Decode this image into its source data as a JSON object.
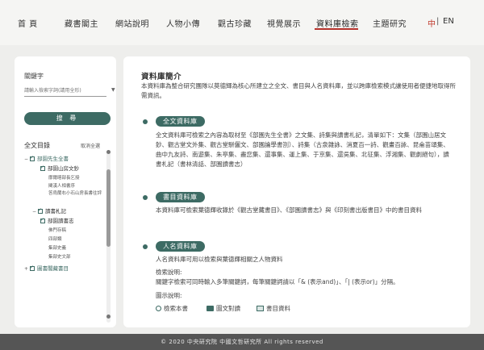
{
  "nav": {
    "items": [
      "首  頁",
      "藏書閣主",
      "網站說明",
      "人物小傳",
      "觀古珍藏",
      "視覺展示",
      "資料庫檢索",
      "主題研究"
    ],
    "lang_zh": "中",
    "lang_sep": "|",
    "lang_en": "EN"
  },
  "left": {
    "keyword_label": "關鍵字",
    "keyword_placeholder": "請輸入檢索字詞(請用全形)",
    "search_button": "搜  尋",
    "tree_title": "全文目錄",
    "toggle_all": "取消全選",
    "tree": [
      {
        "label": "部園先生全書",
        "level": 0,
        "checked": true,
        "toggle": "−"
      },
      {
        "label": "部園山房文鈔",
        "level": 1,
        "checked": true
      },
      {
        "label": "廓爾喀部長乞授",
        "level": 2,
        "small": true
      },
      {
        "label": "閩漢人相書序",
        "level": 2,
        "small": true
      },
      {
        "label": "答烏蘭右小石山房長書往評",
        "level": 2,
        "small": true
      },
      {
        "label": "讀書札記",
        "level": 1,
        "checked": true,
        "toggle": "−"
      },
      {
        "label": "部園讀書志",
        "level": 1,
        "checked": true
      },
      {
        "label": "佛門存稿",
        "level": 2,
        "small": true
      },
      {
        "label": "四部類",
        "level": 2,
        "small": true
      },
      {
        "label": "集部史義",
        "level": 2,
        "small": true
      },
      {
        "label": "集部史文部",
        "level": 2,
        "small": true
      },
      {
        "label": "圖書閣藏書目",
        "level": 0,
        "checked": true,
        "toggle": "+"
      }
    ]
  },
  "right": {
    "heading": "資料庫簡介",
    "intro": "本資料庫為整合研究團隊以莫德輝為核心所建立之全文、書目與人名資料庫，並以跨庫檢索模式讓使用者便捷地取得所需資訊。",
    "sections": [
      {
        "title": "全文資料庫",
        "text": "全文資料庫可檢索之內容為取材至《部園先生全書》之文集、詩集與讀書札記，清單如下：文集（部園山居文鈔、觀古堂文外集、觀古堂駢儷文、部園論學書劄）、詩集（古泉雜詠、消夏百一詩、觀畫百詠、昆侖苗頌集、曲中九友詩、南遊集、朱亭集、盡您集、還事集、運上集、于京集、還吳集、北征集、浮湘集、觀劇絕句），讀書札記（書林清話、部園讀書志）"
      },
      {
        "title": "書目資料庫",
        "text": "本資料庫可檢索葉德輝收錄於《觀古堂藏書目》、《部園讀書志》與《印刻書出版書目》中的書目資料"
      },
      {
        "title": "人名資料庫",
        "text": "人名資料庫可用以檢索與葉德輝相關之人物資料"
      }
    ],
    "search_help_title": "檢索說明:",
    "search_help_text": "關鍵字檢索可同時輸入多筆關鍵詞，每筆關鍵詞請以「& (表示and)」、「| (表示or)」分隔。",
    "legend_title": "圖示說明:",
    "legend": [
      {
        "icon": "search-icon",
        "label": "檢索本書"
      },
      {
        "icon": "image-icon",
        "label": "圖文對讀"
      },
      {
        "icon": "book-icon",
        "label": "書目資料"
      }
    ]
  },
  "footer": "© 2020 中央研究院 中國文哲研究所 All rights reserved"
}
